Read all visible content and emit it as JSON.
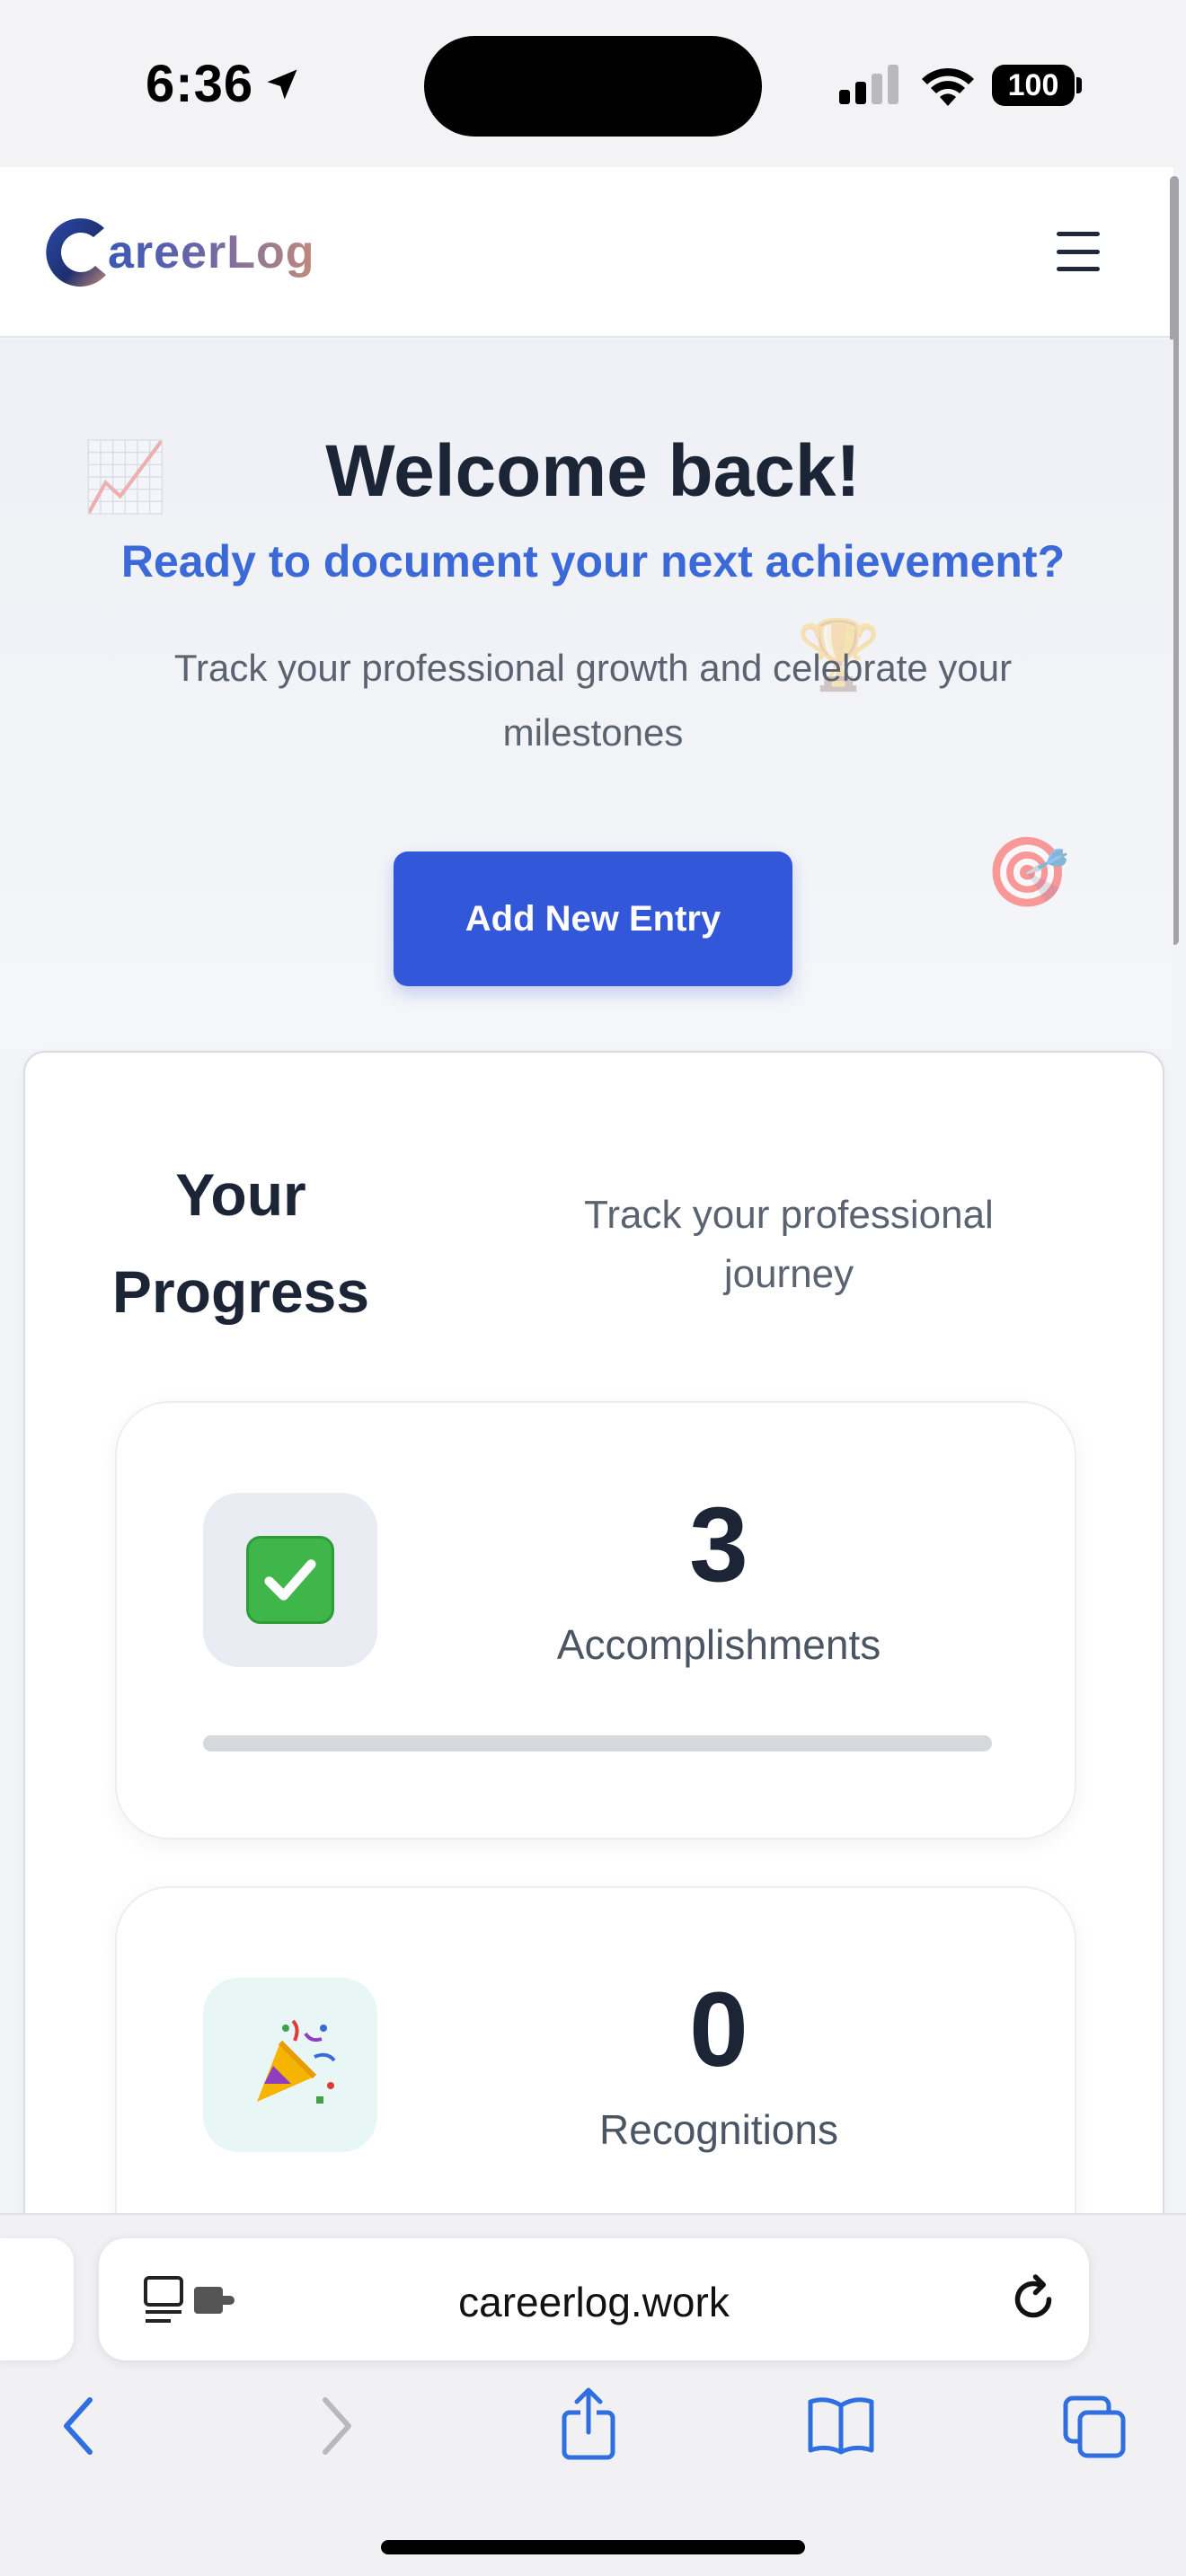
{
  "status_bar": {
    "time": "6:36",
    "battery": "100"
  },
  "header": {
    "logo_text": "areerLog",
    "logo_letter": "C"
  },
  "hero": {
    "title": "Welcome back!",
    "subtitle": "Ready to document your next achievement?",
    "description": "Track your professional growth and celebrate your milestones",
    "add_button_label": "Add New Entry",
    "decorations": [
      "chart-emoji",
      "trophy-emoji",
      "target-emoji"
    ]
  },
  "progress": {
    "title": "Your Progress",
    "subtitle": "Track your professional journey",
    "stats": [
      {
        "icon": "check-mark-emoji",
        "value": "3",
        "label": "Accomplishments",
        "progress": 0
      },
      {
        "icon": "party-popper-emoji",
        "value": "0",
        "label": "Recognitions"
      }
    ]
  },
  "browser": {
    "url": "careerlog.work",
    "toolbar": [
      "back",
      "forward",
      "share",
      "bookmarks",
      "tabs"
    ]
  },
  "colors": {
    "accent": "#3357d9",
    "subtitle": "#3b6ad8",
    "title": "#1c2536"
  }
}
